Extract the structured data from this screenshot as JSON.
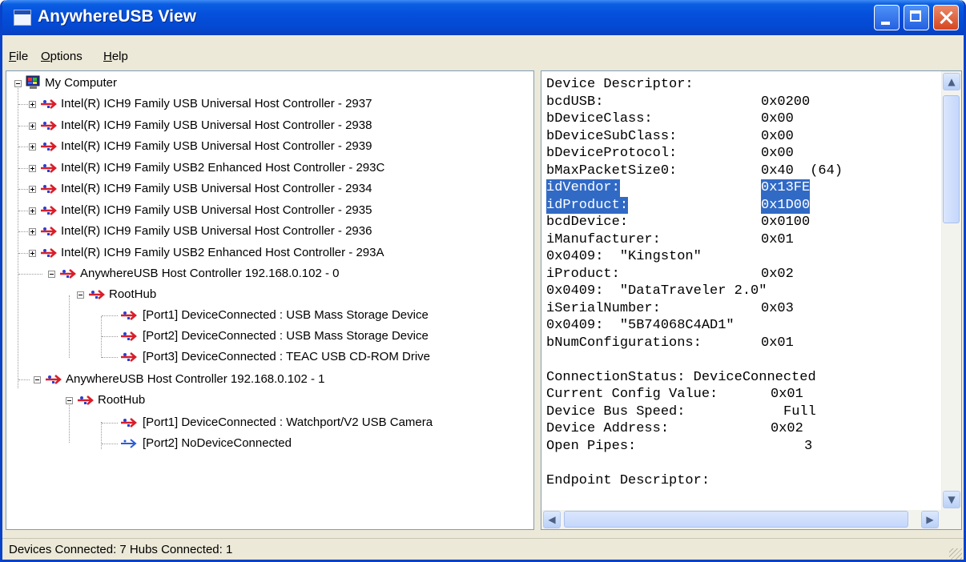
{
  "window": {
    "title": "AnywhereUSB View"
  },
  "menu": [
    {
      "label": "File",
      "accel": "F",
      "rest": "ile"
    },
    {
      "label": "Options",
      "accel": "O",
      "rest": "ptions"
    },
    {
      "label": "Help",
      "accel": "H",
      "rest": "elp"
    }
  ],
  "tree": {
    "root": "My Computer",
    "controllers": [
      "Intel(R) ICH9 Family USB Universal Host Controller - 2937",
      "Intel(R) ICH9 Family USB Universal Host Controller - 2938",
      "Intel(R) ICH9 Family USB Universal Host Controller - 2939",
      "Intel(R) ICH9 Family USB2 Enhanced Host Controller - 293C",
      "Intel(R) ICH9 Family USB Universal Host Controller - 2934",
      "Intel(R) ICH9 Family USB Universal Host Controller - 2935",
      "Intel(R) ICH9 Family USB Universal Host Controller - 2936",
      "Intel(R) ICH9 Family USB2 Enhanced Host Controller - 293A"
    ],
    "anywhere0": {
      "label": "AnywhereUSB Host Controller 192.168.0.102 - 0",
      "hub": "RootHub",
      "ports": [
        "[Port1] DeviceConnected :  USB Mass Storage Device",
        "[Port2] DeviceConnected :  USB Mass Storage Device",
        "[Port3] DeviceConnected :  TEAC USB CD-ROM Drive"
      ]
    },
    "anywhere1": {
      "label": "AnywhereUSB Host Controller 192.168.0.102 - 1",
      "hub": "RootHub",
      "ports": [
        "[Port1] DeviceConnected :  Watchport/V2 USB Camera",
        "[Port2] NoDeviceConnected"
      ]
    }
  },
  "details": [
    {
      "key": "Device Descriptor:",
      "value": ""
    },
    {
      "key": "bcdUSB:",
      "value": "0x0200"
    },
    {
      "key": "bDeviceClass:",
      "value": "0x00"
    },
    {
      "key": "bDeviceSubClass:",
      "value": "0x00"
    },
    {
      "key": "bDeviceProtocol:",
      "value": "0x00"
    },
    {
      "key": "bMaxPacketSize0:",
      "value": "0x40  (64)"
    },
    {
      "key": "idVendor:",
      "value": "0x13FE"
    },
    {
      "key": "idProduct:",
      "value": "0x1D00"
    },
    {
      "key": "bcdDevice:",
      "value": "0x0100"
    },
    {
      "key": "iManufacturer:",
      "value": "0x01"
    },
    {
      "key": "0x0409:  \"Kingston\"",
      "value": ""
    },
    {
      "key": "iProduct:",
      "value": "0x02"
    },
    {
      "key": "0x0409:  \"DataTraveler 2.0\"",
      "value": ""
    },
    {
      "key": "iSerialNumber:",
      "value": "0x03"
    },
    {
      "key": "0x0409:  \"5B74068C4AD1\"",
      "value": ""
    },
    {
      "key": "bNumConfigurations:",
      "value": "0x01"
    },
    {
      "key": "",
      "value": ""
    },
    {
      "key": "ConnectionStatus: DeviceConnected",
      "value": ""
    },
    {
      "key": "Current Config Value:",
      "value": "0x01"
    },
    {
      "key": "Device Bus Speed:",
      "value": "Full"
    },
    {
      "key": "Device Address:",
      "value": "0x02"
    },
    {
      "key": "Open Pipes:",
      "value": "3"
    },
    {
      "key": "",
      "value": ""
    },
    {
      "key": "Endpoint Descriptor:",
      "value": ""
    }
  ],
  "status": {
    "text": "Devices Connected: 7   Hubs Connected: 1"
  }
}
